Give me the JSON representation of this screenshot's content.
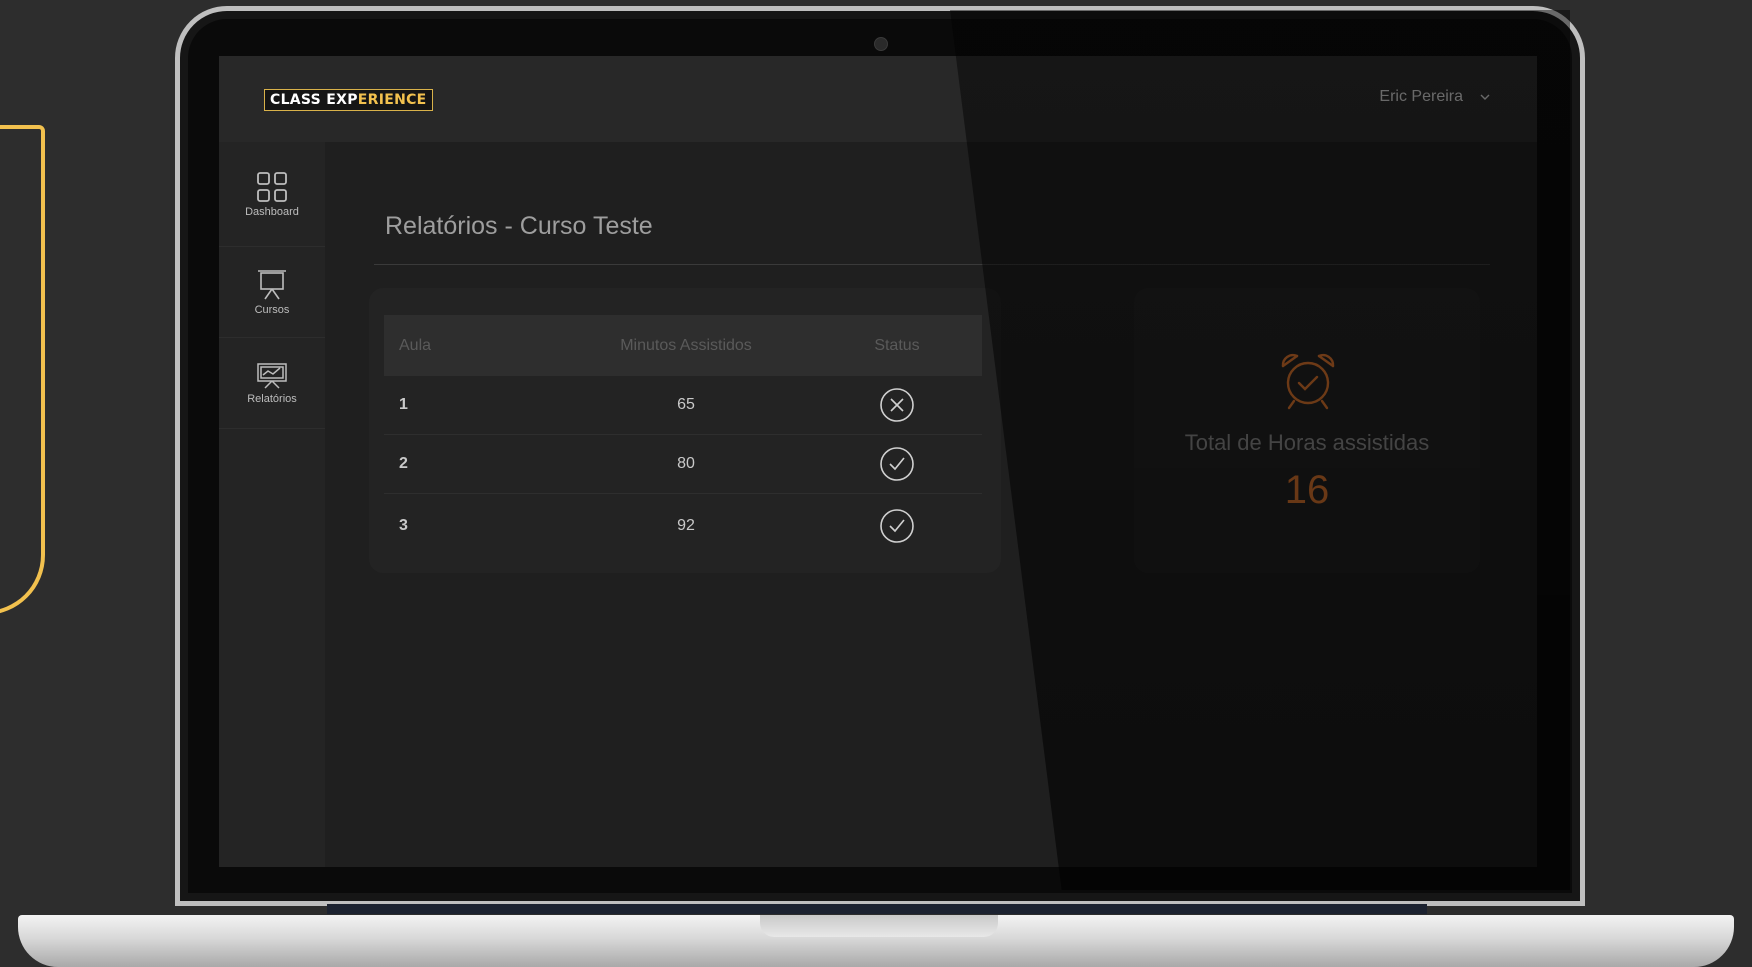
{
  "header": {
    "logo_main": "CLASS EXP",
    "logo_accent": "ERIENCE",
    "user_name": "Eric Pereira"
  },
  "sidebar": {
    "items": [
      {
        "label": "Dashboard",
        "icon": "grid-icon"
      },
      {
        "label": "Cursos",
        "icon": "presentation-board-icon"
      },
      {
        "label": "Relatórios",
        "icon": "chart-board-icon"
      }
    ]
  },
  "main": {
    "title": "Relatórios - Curso Teste",
    "table": {
      "columns": [
        "Aula",
        "Minutos Assistidos",
        "Status"
      ],
      "rows": [
        {
          "aula": "1",
          "minutos": "65",
          "status": "incomplete"
        },
        {
          "aula": "2",
          "minutos": "80",
          "status": "complete"
        },
        {
          "aula": "3",
          "minutos": "92",
          "status": "complete"
        }
      ]
    },
    "summary": {
      "label": "Total de Horas assistidas",
      "value": "16",
      "icon": "alarm-clock-icon"
    }
  },
  "colors": {
    "accent_orange": "#e0772e",
    "logo_yellow": "#f2c14e",
    "background": "#1f1f1f"
  }
}
